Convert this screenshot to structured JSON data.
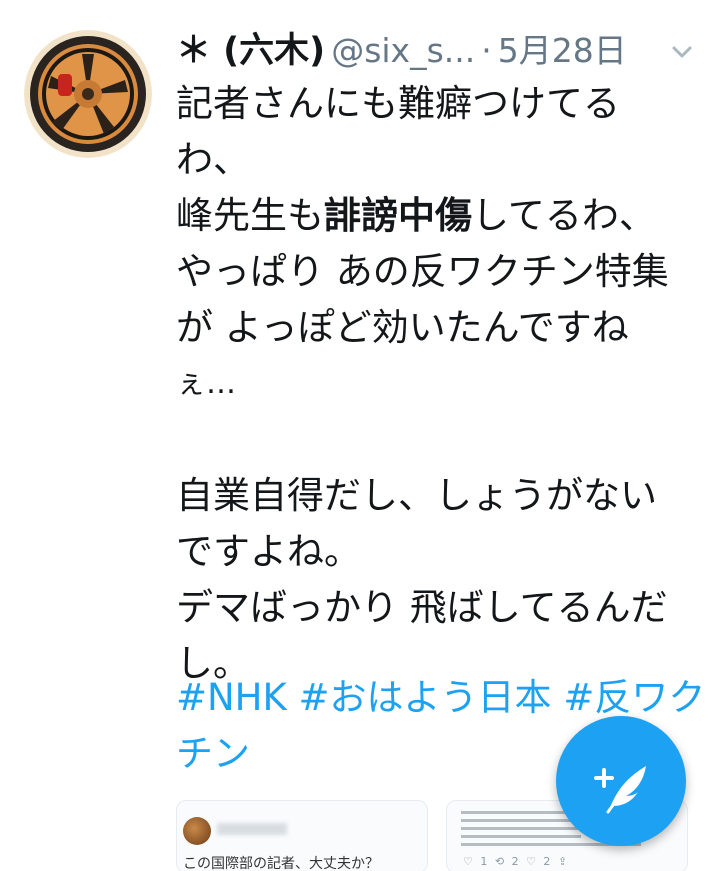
{
  "tweet": {
    "display_name": "＊ (六木)",
    "handle": "@six_s...",
    "separator": "·",
    "date": "5月28日",
    "body": {
      "l1": "記者さんにも難癖つけてる",
      "l2": "わ、",
      "l3_pre": "峰先生も",
      "l3_bold": "誹謗中傷",
      "l3_post": "してるわ、",
      "l4": "やっぱり あの反ワクチン特集",
      "l5": "が よっぽど効いたんですね",
      "l6": "ぇ…",
      "l7": "自業自得だし、しょうがない",
      "l8": "ですよね。",
      "l9": "デマばっかり 飛ばしてるんだ",
      "l10": "し。"
    },
    "hashtags": {
      "nhk": "#NHK",
      "ohayou": "#おはよう日本",
      "anti_vax_1": "#反ワク",
      "anti_vax_2": "チン"
    }
  },
  "cards": {
    "card1_text": "この国際部の記者、大丈夫か？",
    "card2_icons": "♡ 1   ⟲ 2   ♡ 2   ⇪"
  },
  "icons": {
    "menu": "chevron-down-icon",
    "compose": "compose-quill-icon",
    "avatar": "wheel-avatar"
  },
  "colors": {
    "accent": "#1da1f2",
    "text": "#14171a",
    "muted": "#657786"
  }
}
